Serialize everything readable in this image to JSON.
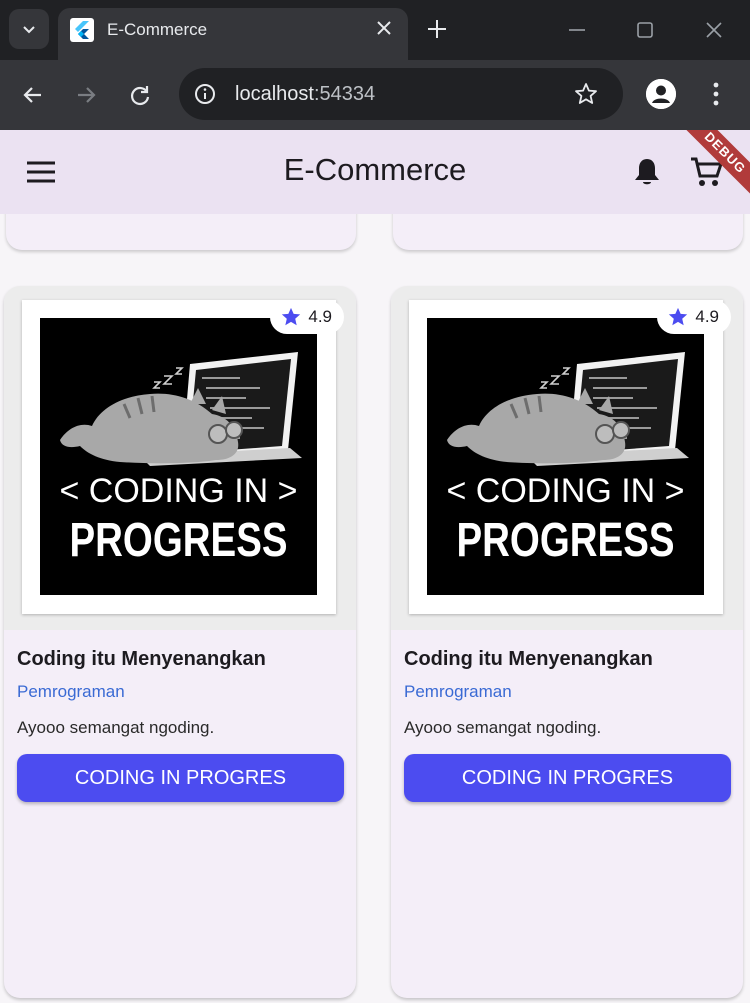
{
  "browser": {
    "tab_title": "E-Commerce",
    "url_host": "localhost",
    "url_port": ":54334"
  },
  "app": {
    "title": "E-Commerce",
    "debug_banner": "DEBUG"
  },
  "products": [
    {
      "title": "Coding itu Menyenangkan",
      "category": "Pemrograman",
      "description": "Ayooo semangat ngoding.",
      "rating": "4.9",
      "button_label": "CODING IN PROGRES",
      "poster_line1": "< CODING IN >",
      "poster_line2": "PROGRESS"
    },
    {
      "title": "Coding itu Menyenangkan",
      "category": "Pemrograman",
      "description": "Ayooo semangat ngoding.",
      "rating": "4.9",
      "button_label": "CODING IN PROGRES",
      "poster_line1": "< CODING IN >",
      "poster_line2": "PROGRESS"
    }
  ],
  "colors": {
    "appbar": "#ebe2f2",
    "button": "#4c4cf0",
    "category": "#3a6ad4",
    "star": "#4c4cf0"
  },
  "icons": [
    "tab-search-icon",
    "flutter-icon",
    "close-icon",
    "plus-icon",
    "minimize-icon",
    "maximize-icon",
    "back-icon",
    "forward-icon",
    "reload-icon",
    "info-icon",
    "star-icon",
    "profile-icon",
    "menu-icon",
    "hamburger-icon",
    "bell-icon",
    "cart-icon"
  ]
}
